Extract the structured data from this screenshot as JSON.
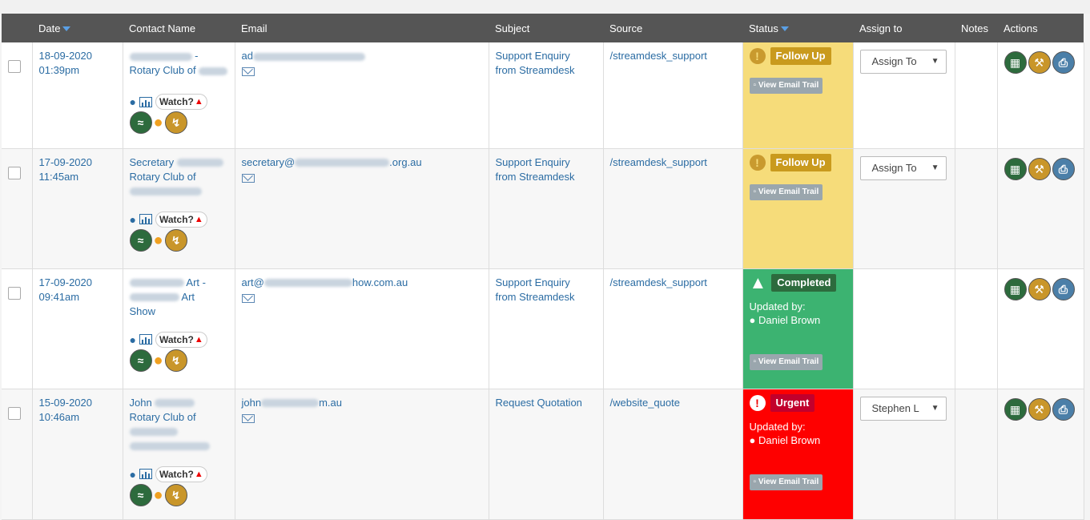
{
  "columns": {
    "date": "Date",
    "contact": "Contact Name",
    "email": "Email",
    "subject": "Subject",
    "source": "Source",
    "status": "Status",
    "assign": "Assign to",
    "notes": "Notes",
    "actions": "Actions"
  },
  "labels": {
    "watch": "Watch?",
    "view_trail": "View Email Trail",
    "updated_by": "Updated by:"
  },
  "rows": [
    {
      "date": "18-09-2020",
      "time": "01:39pm",
      "contact_line1": "-",
      "contact_line2": "Rotary Club of",
      "contact_line3": "",
      "email_prefix": "ad",
      "email_suffix": "",
      "subject_line1": "Support Enquiry",
      "subject_line2": "from Streamdesk",
      "source": "/streamdesk_support",
      "status": "Follow Up",
      "updated_by": "",
      "assign": "Assign To"
    },
    {
      "date": "17-09-2020",
      "time": "11:45am",
      "contact_line1": "Secretary",
      "contact_line2": "Rotary Club of",
      "contact_line3": "",
      "email_prefix": "secretary@",
      "email_suffix": ".org.au",
      "subject_line1": "Support Enquiry",
      "subject_line2": "from Streamdesk",
      "source": "/streamdesk_support",
      "status": "Follow Up",
      "updated_by": "",
      "assign": "Assign To"
    },
    {
      "date": "17-09-2020",
      "time": "09:41am",
      "contact_line1": "Art -",
      "contact_line2": "Art",
      "contact_line3": "Show",
      "email_prefix": "art@",
      "email_suffix": "how.com.au",
      "subject_line1": "Support Enquiry",
      "subject_line2": "from Streamdesk",
      "source": "/streamdesk_support",
      "status": "Completed",
      "updated_by": "Daniel Brown",
      "assign": ""
    },
    {
      "date": "15-09-2020",
      "time": "10:46am",
      "contact_line1": "John",
      "contact_line2": "Rotary Club of",
      "contact_line3": "",
      "email_prefix": "john",
      "email_suffix": "m.au",
      "subject_line1": "Request Quotation",
      "subject_line2": "",
      "source": "/website_quote",
      "status": "Urgent",
      "updated_by": "Daniel Brown",
      "assign": "Stephen L"
    }
  ],
  "colors": {
    "header_bg": "#555555",
    "follow_up_bg": "#f6dc7a",
    "completed_bg": "#3cb371",
    "urgent_bg": "#fe0000",
    "link": "#2b6ca3"
  }
}
